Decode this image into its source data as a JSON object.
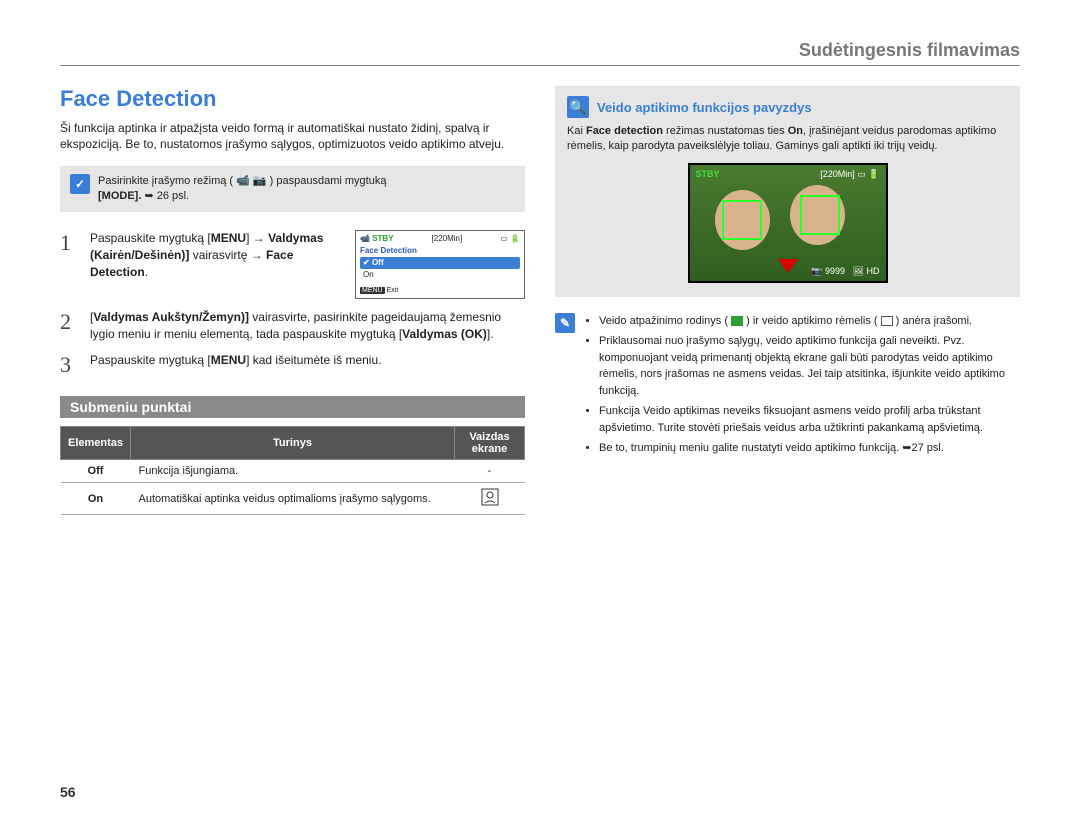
{
  "header": {
    "chapter": "Sudėtingesnis filmavimas"
  },
  "section": {
    "title": "Face Detection",
    "intro": "Ši funkcija aptinka ir atpažįsta veido formą ir automatiškai nustato židinį, spalvą ir ekspoziciją. Be to, nustatomos įrašymo sąlygos, optimizuotos veido aptikimo atveju."
  },
  "mode_note": {
    "prefix": "Pasirinkite įrašymo režimą ( ",
    "suffix": " ) paspausdami mygtuką",
    "line2_a": "[MODE]. ",
    "line2_b": "26 psl."
  },
  "steps": [
    {
      "num": "1",
      "segments": [
        "Paspauskite mygtuką [",
        "MENU",
        "] → ",
        "Valdymas (Kairėn/Dešinėn)]",
        " vairasvirtę → ",
        "Face Detection",
        "."
      ]
    },
    {
      "num": "2",
      "segments": [
        "[",
        "Valdymas Aukštyn/Žemyn)]",
        " vairasvirte, pasirinkite pageidaujamą žemesnio lygio meniu ir meniu elementą, tada paspauskite mygtuką [",
        "Valdymas (OK)",
        "]."
      ]
    },
    {
      "num": "3",
      "segments": [
        "Paspauskite mygtuką [",
        "MENU",
        "] kad išeitumėte iš meniu."
      ]
    }
  ],
  "lcd": {
    "stby": "STBY",
    "time": "[220Min]",
    "menu_title": "Face Detection",
    "opt_off": "Off",
    "opt_on": "On",
    "exit_label": "MENU",
    "exit_text": "Exit"
  },
  "submenu": {
    "bar": "Submeniu punktai",
    "head": {
      "el": "Elementas",
      "content": "Turinys",
      "pic": "Vaizdas ekrane"
    },
    "rows": [
      {
        "elem": "Off",
        "content": "Funkcija išjungiama.",
        "pic": "-"
      },
      {
        "elem": "On",
        "content": "Automatiškai aptinka veidus optimalioms įrašymo sąlygoms.",
        "pic": "icon"
      }
    ]
  },
  "example": {
    "title": "Veido aptikimo funkcijos pavyzdys",
    "body_a": "Kai ",
    "body_b": "Face detection",
    "body_c": " režimas nustatomas ties ",
    "body_d": "On",
    "body_e": ", įrašinėjant veidus parodomas aptikimo rėmelis, kaip parodyta paveikslėlyje toliau. Gaminys gali aptikti iki trijų veidų.",
    "overlay": {
      "stby": "STBY",
      "time": "[220Min]",
      "count": "9999",
      "hd": "HD"
    }
  },
  "info": {
    "bullet1_a": "Veido atpažinimo rodinys ( ",
    "bullet1_b": " ) ir veido aptikimo rėmelis ( ",
    "bullet1_c": " ) anėra įrašomi.",
    "bullet2": "Priklausomai nuo įrašymo sąlygų, veido aptikimo funkcija gali neveikti. Pvz. komponuojant veidą primenantį objektą ekrane gali būti parodytas veido aptikimo rėmelis, nors įrašomas ne asmens veidas. Jei taip atsitinka, išjunkite veido aptikimo funkciją.",
    "bullet3": "Funkcija Veido aptikimas neveiks fiksuojant asmens veido profilį arba trūkstant apšvietimo. Turite stovėti priešais veidus arba užtikrinti pakankamą apšvietimą.",
    "bullet4_a": "Be to, trumpinių meniu galite nustatyti veido aptikimo funkciją. ",
    "bullet4_b": "27 psl."
  },
  "page_num": "56"
}
